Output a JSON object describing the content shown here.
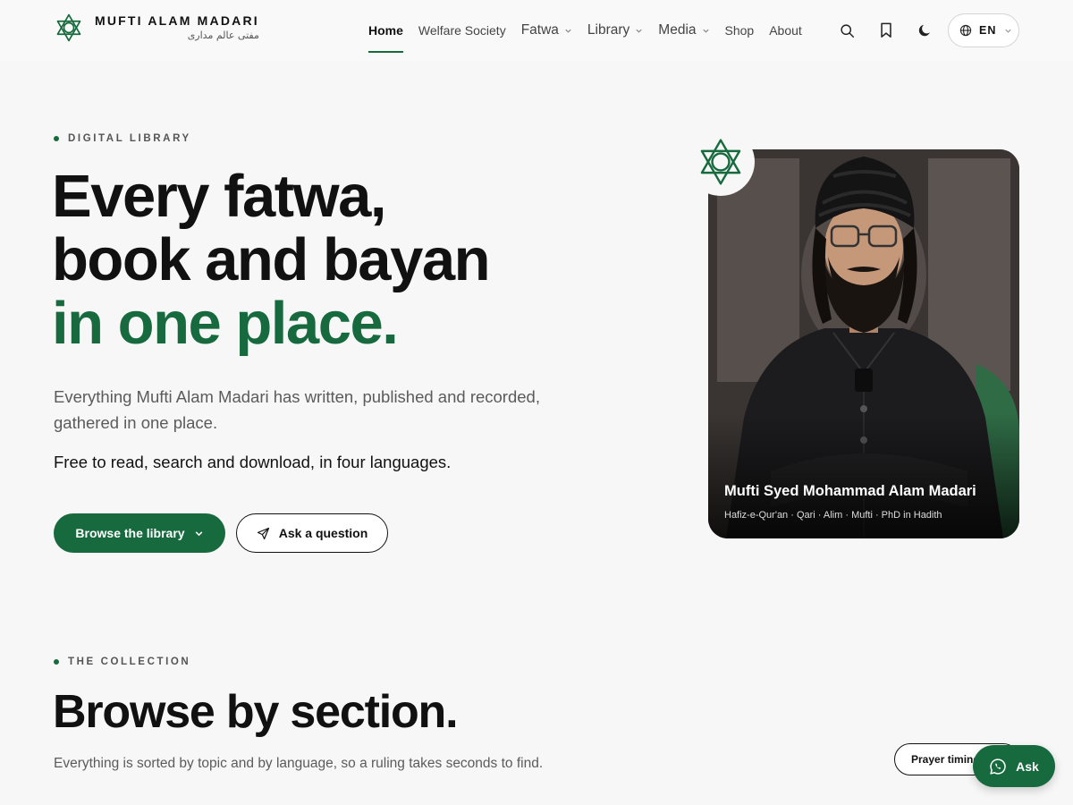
{
  "header": {
    "brand_en": "MUFTI ALAM MADARI",
    "brand_ur": "مفتی عالم مداری",
    "nav": [
      {
        "label": "Home",
        "active": true,
        "has_dropdown": false
      },
      {
        "label": "Welfare Society",
        "active": false,
        "has_dropdown": false
      },
      {
        "label": "Fatwa",
        "active": false,
        "has_dropdown": true
      },
      {
        "label": "Library",
        "active": false,
        "has_dropdown": true
      },
      {
        "label": "Media",
        "active": false,
        "has_dropdown": true
      },
      {
        "label": "Shop",
        "active": false,
        "has_dropdown": false
      },
      {
        "label": "About",
        "active": false,
        "has_dropdown": false
      }
    ],
    "icons": [
      "search-icon",
      "bookmark-icon",
      "moon-icon",
      "globe-icon"
    ],
    "language": "EN"
  },
  "hero": {
    "eyebrow": "DIGITAL LIBRARY",
    "title_line1": "Every fatwa,",
    "title_line2": "book and bayan",
    "title_line3": "in one place.",
    "lead": "Everything Mufti Alam Madari has written, published and recorded, gathered in one place.",
    "sub": "Free to read, search and download, in four languages.",
    "primary_button": "Browse the library",
    "secondary_button": "Ask a question",
    "portrait_name": "Mufti Syed Mohammad Alam Madari",
    "portrait_caption": "Hafiz-e-Qur'an · Qari · Alim · Mufti · PhD in Hadith"
  },
  "collection": {
    "eyebrow": "THE COLLECTION",
    "title": "Browse by section.",
    "lead": "Everything is sorted by topic and by language, so a ruling takes seconds to find."
  },
  "floating": {
    "prayer_button": "Prayer timings",
    "ask_button": "Ask"
  },
  "colors": {
    "accent": "#176a3e",
    "background": "#f7f7f7",
    "text": "#111111"
  }
}
